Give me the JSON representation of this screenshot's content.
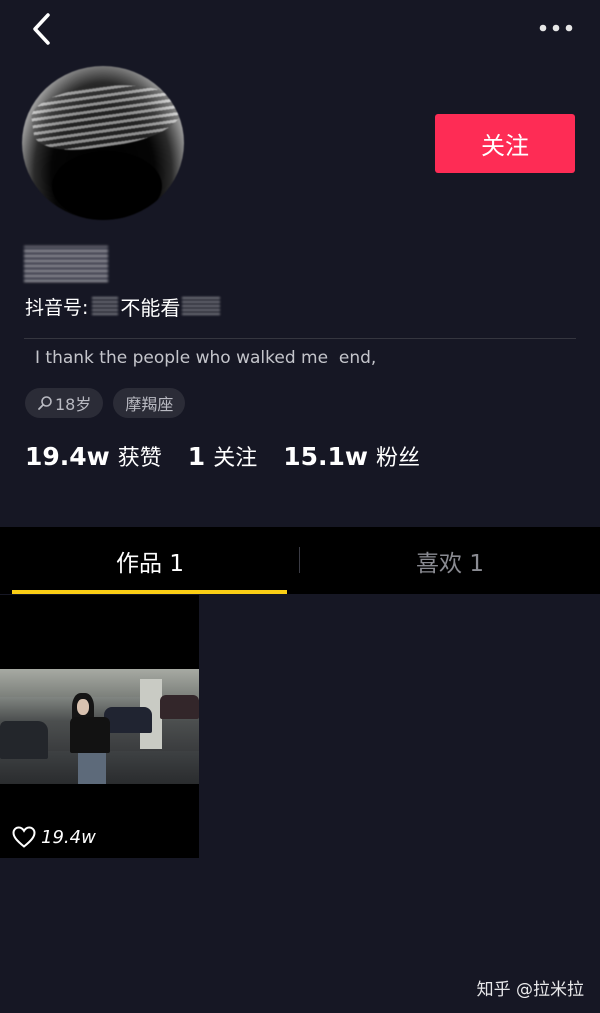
{
  "topbar": {
    "back_icon": "chevron-left-icon",
    "more_icon": "more-dots-icon"
  },
  "profile": {
    "follow_label": "关注",
    "douyin_id_label": "抖音号:",
    "douyin_id_value": "不能看",
    "bio": "I thank the people who walked me  end,",
    "tags": [
      {
        "icon": "search-icon",
        "label": "18岁"
      },
      {
        "icon": "",
        "label": "摩羯座"
      }
    ],
    "stats": [
      {
        "num": "19.4w",
        "label": "获赞"
      },
      {
        "num": "1",
        "label": "关注"
      },
      {
        "num": "15.1w",
        "label": "粉丝"
      }
    ]
  },
  "tabs": [
    {
      "label": "作品 1",
      "active": true
    },
    {
      "label": "喜欢 1",
      "active": false
    }
  ],
  "videos": [
    {
      "likes": "19.4w",
      "icon": "heart-icon"
    }
  ],
  "watermark": "知乎 @拉米拉",
  "colors": {
    "background": "#161724",
    "follow": "#fe2c55",
    "tab_indicator": "#face15"
  }
}
